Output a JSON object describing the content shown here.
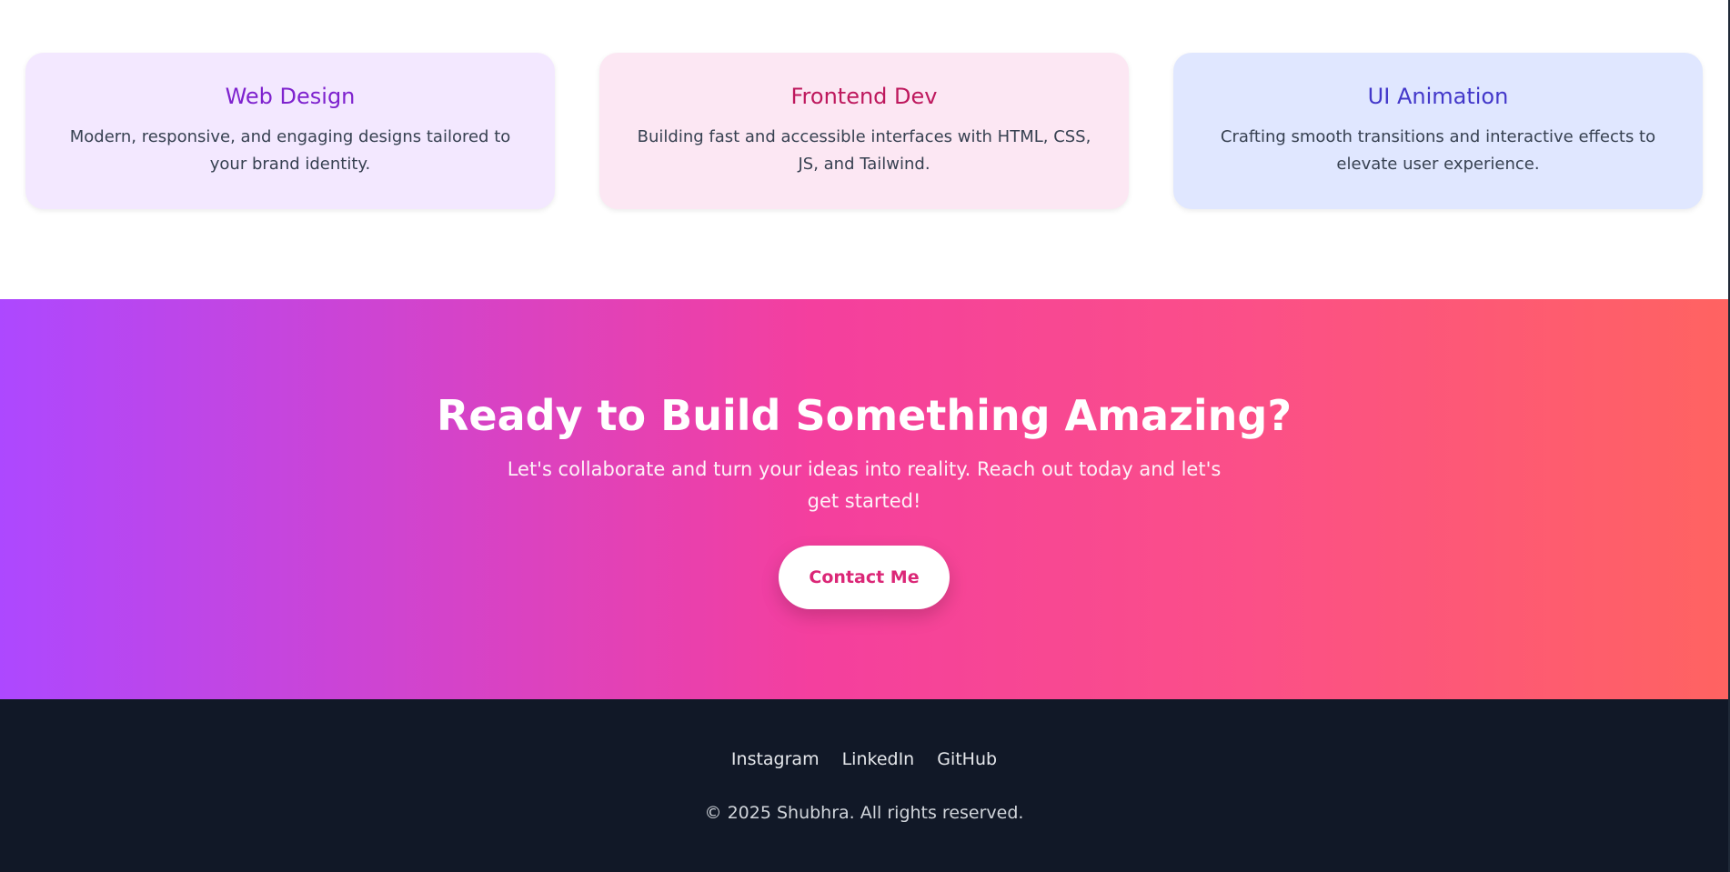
{
  "services": {
    "cards": [
      {
        "title": "Web Design",
        "description": "Modern, responsive, and engaging designs tailored to your brand identity."
      },
      {
        "title": "Frontend Dev",
        "description": "Building fast and accessible interfaces with HTML, CSS, JS, and Tailwind."
      },
      {
        "title": "UI Animation",
        "description": "Crafting smooth transitions and interactive effects to elevate user experience."
      }
    ]
  },
  "cta": {
    "title": "Ready to Build Something Amazing?",
    "subtitle": "Let's collaborate and turn your ideas into reality. Reach out today and let's get started!",
    "button_label": "Contact Me"
  },
  "footer": {
    "links": [
      "Instagram",
      "LinkedIn",
      "GitHub"
    ],
    "copyright": "© 2025 Shubhra. All rights reserved."
  },
  "colors": {
    "web_design_accent": "#7e22ce",
    "frontend_accent": "#be185d",
    "animation_accent": "#4338ca",
    "cta_gradient": [
      "#ad48ff",
      "#f43f9e",
      "#ff6361"
    ],
    "footer_bg": "#111827"
  }
}
